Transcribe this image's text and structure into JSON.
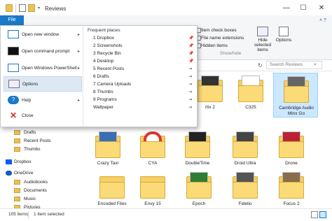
{
  "window": {
    "title": "Reviews",
    "minimize": "—",
    "maximize": "☐",
    "close": "✕"
  },
  "quick_access": {
    "dropdown": "▾"
  },
  "ribbon": {
    "file_tab": "File",
    "item_check_boxes": "Item check boxes",
    "file_name_extensions": "File name extensions",
    "hidden_items": "Hidden items",
    "group_label": "Show/hide",
    "hide_selected_items": "Hide selected items",
    "options": "Options",
    "collapse": "˄",
    "help": "?"
  },
  "navbar": {
    "refresh": "↻",
    "search_placeholder": "Search Reviews",
    "search_icon": "⌕"
  },
  "file_menu": {
    "items": [
      {
        "label": "Open new window",
        "arrow": "▸",
        "icon": "window-icon"
      },
      {
        "label": "Open command prompt",
        "arrow": "▸",
        "icon": "command-prompt-icon"
      },
      {
        "label": "Open Windows PowerShell",
        "arrow": "▸",
        "icon": "powershell-icon"
      },
      {
        "label": "Options",
        "arrow": "",
        "icon": "options-icon"
      },
      {
        "label": "Help",
        "arrow": "▸",
        "icon": "help-icon"
      },
      {
        "label": "Close",
        "arrow": "",
        "icon": "close-icon"
      }
    ],
    "frequent_title": "Frequent places",
    "frequent": [
      {
        "label": "1 Dropbox",
        "pin": "📌"
      },
      {
        "label": "2 Screenshots",
        "pin": "📌"
      },
      {
        "label": "3 Recycle Bin",
        "pin": "📌"
      },
      {
        "label": "4 Desktop",
        "pin": "📌"
      },
      {
        "label": "5 Recent Posts",
        "pin": "⇥"
      },
      {
        "label": "6 Drafts",
        "pin": "⇥"
      },
      {
        "label": "7 Camera Uploads",
        "pin": "⇥"
      },
      {
        "label": "8 Thumbs",
        "pin": "⇥"
      },
      {
        "label": "9 Programs",
        "pin": "⇥"
      },
      {
        "label": "Wallpaper",
        "pin": "⇥"
      }
    ]
  },
  "nav": {
    "items": [
      "Drafts",
      "Recent Posts",
      "Thumbs",
      "Dropbox",
      "OneDrive",
      "Audiobooks",
      "Documents",
      "Music",
      "Pictures"
    ]
  },
  "content": {
    "row1": [
      "rtix 2",
      "C325",
      "Cambridge Audio Minx Go"
    ],
    "row2": [
      "Crazy Taxi",
      "CYA",
      "DoubleTime",
      "Droid Ultra",
      "Drone"
    ],
    "row3": [
      "Encoded Files",
      "Envy 15",
      "Epoch",
      "Fidelio",
      "Focus 2"
    ]
  },
  "status": {
    "count": "105 items",
    "selected": "1 item selected"
  },
  "colors": {
    "accent": "#1979ca",
    "folder": "#f7cf63",
    "selection": "#cce8ff"
  }
}
